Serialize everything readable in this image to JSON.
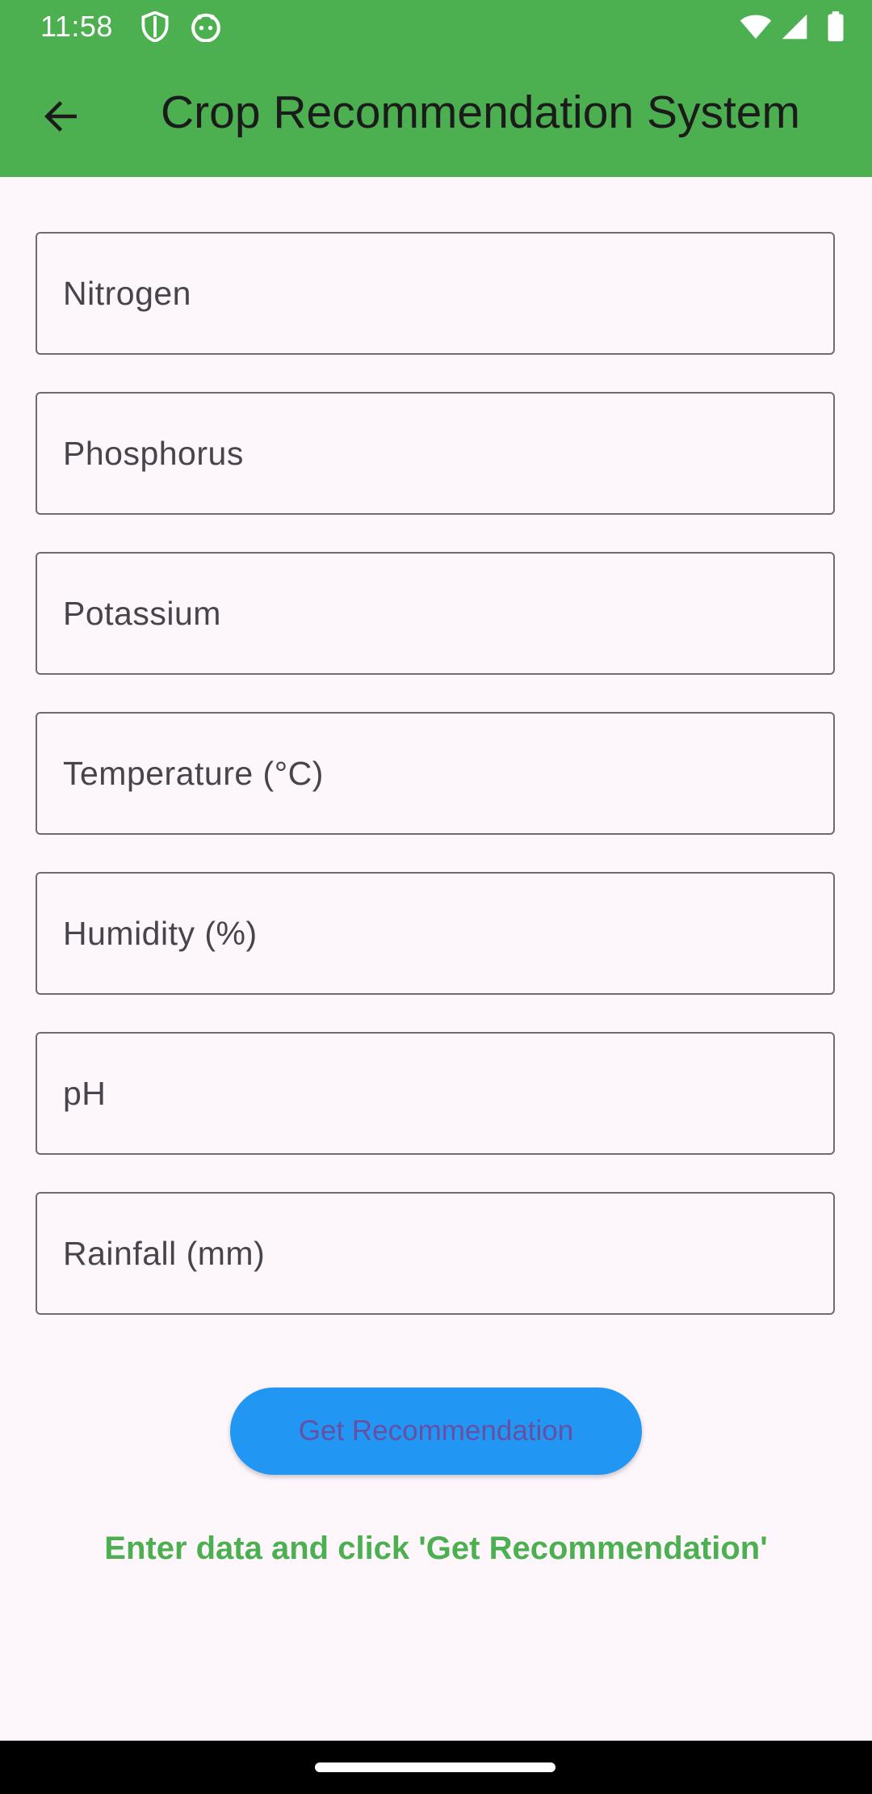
{
  "status_bar": {
    "time": "11:58",
    "icons": [
      "shield-icon",
      "android-head-icon",
      "wifi-icon",
      "signal-icon",
      "battery-icon"
    ]
  },
  "app_bar": {
    "back_icon": "arrow-left-icon",
    "title": "Crop Recommendation System"
  },
  "form": {
    "fields": [
      {
        "placeholder": "Nitrogen",
        "value": ""
      },
      {
        "placeholder": "Phosphorus",
        "value": ""
      },
      {
        "placeholder": "Potassium",
        "value": ""
      },
      {
        "placeholder": "Temperature (°C)",
        "value": ""
      },
      {
        "placeholder": "Humidity (%)",
        "value": ""
      },
      {
        "placeholder": "pH",
        "value": ""
      },
      {
        "placeholder": "Rainfall (mm)",
        "value": ""
      }
    ]
  },
  "actions": {
    "recommend_label": "Get Recommendation"
  },
  "result": {
    "message": "Enter data and click 'Get Recommendation'"
  },
  "colors": {
    "app_bar": "#4CAF50",
    "background": "#FDF7FC",
    "button": "#2196F3",
    "button_text": "#6750A4",
    "hint_text": "#4CAF50"
  }
}
